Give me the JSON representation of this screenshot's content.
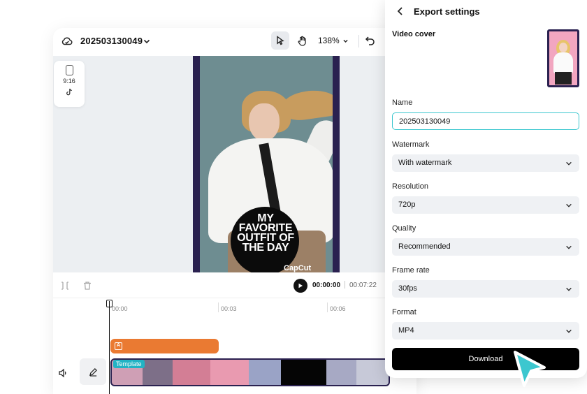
{
  "editor": {
    "project_name": "202503130049",
    "zoom": "138%",
    "ratio": "9:16",
    "preview": {
      "headline": [
        "MY",
        "FAVORITE",
        "OUTFIT OF",
        "THE DAY"
      ],
      "logo": "CapCut"
    },
    "time_current": "00:00:00",
    "time_total": "00:07:22",
    "ruler": [
      "00:00",
      "00:03",
      "00:06"
    ],
    "template_label": "Template"
  },
  "export": {
    "title": "Export settings",
    "video_cover_label": "Video cover",
    "name_label": "Name",
    "name_value": "202503130049",
    "watermark_label": "Watermark",
    "watermark_value": "With watermark",
    "resolution_label": "Resolution",
    "resolution_value": "720p",
    "quality_label": "Quality",
    "quality_value": "Recommended",
    "frame_rate_label": "Frame rate",
    "frame_rate_value": "30fps",
    "format_label": "Format",
    "format_value": "MP4",
    "download_label": "Download"
  },
  "colors": {
    "accent": "#3cc7cf",
    "cursor": "#3cc7cf",
    "text_track": "#ea7a32",
    "preview_frame": "#2a2150"
  }
}
